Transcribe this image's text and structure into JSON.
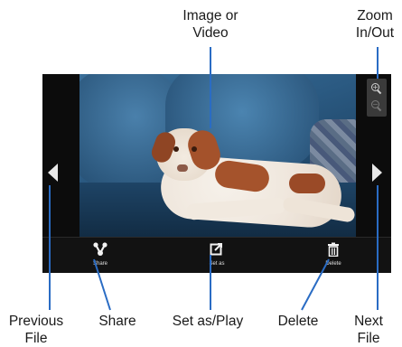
{
  "callouts": {
    "image_or_video": "Image or\nVideo",
    "zoom": "Zoom\nIn/Out",
    "previous_file": "Previous\nFile",
    "share": "Share",
    "set_as_play": "Set as/Play",
    "delete": "Delete",
    "next_file": "Next\nFile"
  },
  "toolbar": {
    "share_label": "Share",
    "set_as_label": "Set as",
    "delete_label": "Delete"
  },
  "icons": {
    "previous": "triangle-left-icon",
    "next": "triangle-right-icon",
    "zoom_in": "zoom-in-icon",
    "zoom_out": "zoom-out-icon",
    "share": "share-icon",
    "set_as": "set-as-icon",
    "delete": "trash-icon"
  },
  "colors": {
    "callout_line": "#2a6cc4",
    "screen_background": "#0b0b0b",
    "toolbar_background": "#121212"
  }
}
